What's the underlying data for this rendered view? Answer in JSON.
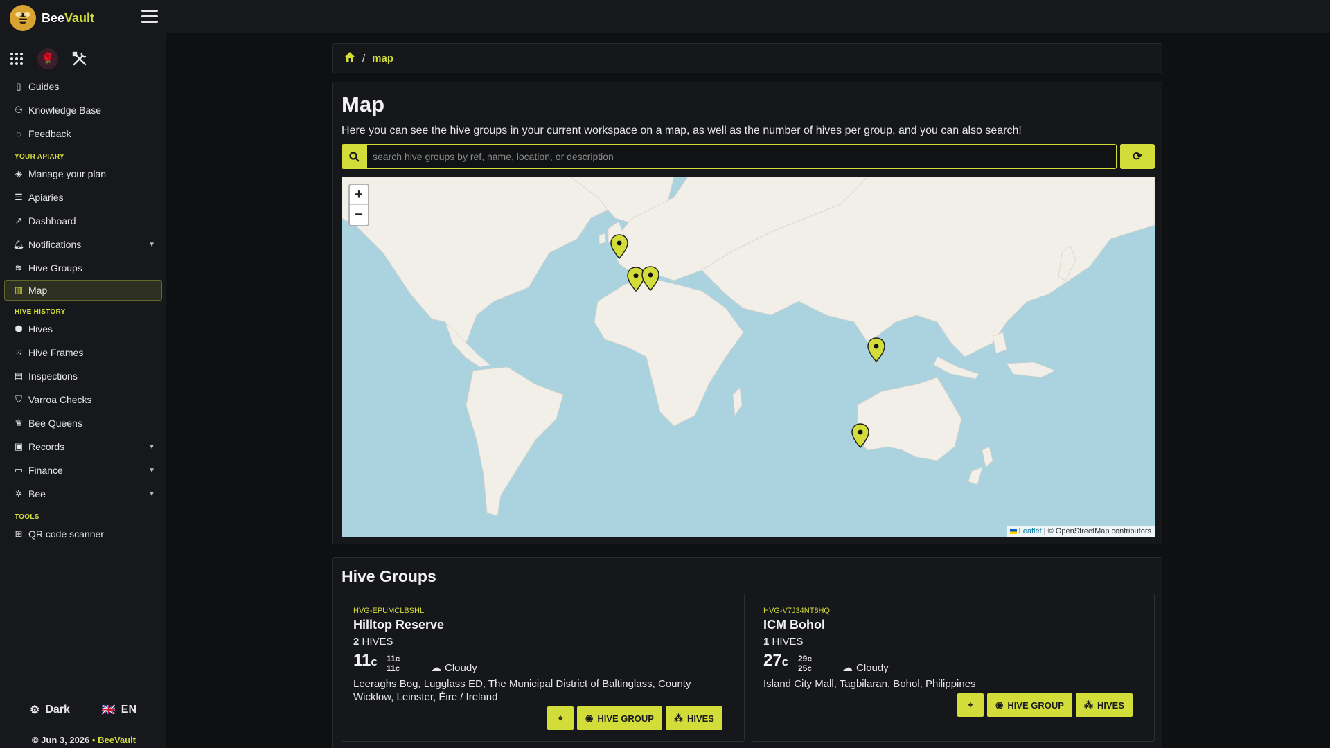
{
  "brand": {
    "name_part1": "Bee",
    "name_part2": "Vault"
  },
  "sidebar": {
    "items_top": [
      {
        "label": "Guides",
        "icon": "book-icon"
      },
      {
        "label": "Knowledge Base",
        "icon": "knowledge-icon"
      },
      {
        "label": "Feedback",
        "icon": "chat-icon"
      }
    ],
    "section_apiary": "YOUR APIARY",
    "items_apiary": [
      {
        "label": "Manage your plan",
        "icon": "box-icon"
      },
      {
        "label": "Apiaries",
        "icon": "list-icon"
      },
      {
        "label": "Dashboard",
        "icon": "chart-line-icon"
      },
      {
        "label": "Notifications",
        "icon": "bell-icon"
      },
      {
        "label": "Hive Groups",
        "icon": "layers-icon"
      },
      {
        "label": "Map",
        "icon": "map-icon"
      }
    ],
    "section_history": "HIVE HISTORY",
    "items_history": [
      {
        "label": "Hives",
        "icon": "hexagon-icon"
      },
      {
        "label": "Hive Frames",
        "icon": "grid-icon"
      },
      {
        "label": "Inspections",
        "icon": "clipboard-icon"
      },
      {
        "label": "Varroa Checks",
        "icon": "shield-icon"
      },
      {
        "label": "Bee Queens",
        "icon": "crown-icon"
      },
      {
        "label": "Records",
        "icon": "record-icon"
      },
      {
        "label": "Finance",
        "icon": "wallet-icon"
      },
      {
        "label": "Bee",
        "icon": "bee-icon"
      }
    ],
    "section_tools": "TOOLS",
    "items_tools": [
      {
        "label": "QR code scanner",
        "icon": "qr-icon"
      }
    ],
    "theme_label": "Dark",
    "lang_label": "EN",
    "footer_date": "© Jun 3, 2026",
    "footer_dot": "•",
    "footer_brand": "BeeVault"
  },
  "breadcrumb": {
    "sep": "/",
    "current": "map"
  },
  "map_section": {
    "title": "Map",
    "description": "Here you can see the hive groups in your current workspace on a map, as well as the number of hives per group, and you can also search!",
    "search_placeholder": "search hive groups by ref, name, location, or description",
    "zoom_in": "+",
    "zoom_out": "−",
    "attribution_leaflet": "Leaflet",
    "attribution_osm": "© OpenStreetMap contributors"
  },
  "groups": {
    "title": "Hive Groups",
    "cards": [
      {
        "ref": "HVG-EPUMCLBSHL",
        "name": "Hilltop Reserve",
        "hive_count": "2",
        "hive_unit": "HIVES",
        "temp": "11",
        "temp_unit": "c",
        "temp_max": "11c",
        "temp_min": "11c",
        "weather": "Cloudy",
        "address": "Leeraghs Bog, Lugglass ED, The Municipal District of Baltinglass, County Wicklow, Leinster, Éire / Ireland",
        "btn_group": "HIVE GROUP",
        "btn_hives": "HIVES"
      },
      {
        "ref": "HVG-V7J34NT8HQ",
        "name": "ICM Bohol",
        "hive_count": "1",
        "hive_unit": "HIVES",
        "temp": "27",
        "temp_unit": "c",
        "temp_max": "29c",
        "temp_min": "25c",
        "weather": "Cloudy",
        "address": "Island City Mall, Tagbilaran, Bohol, Philippines",
        "btn_group": "HIVE GROUP",
        "btn_hives": "HIVES"
      }
    ]
  },
  "colors": {
    "accent": "#d2dd3a",
    "sea": "#aad3df",
    "land": "#f2efe9"
  }
}
